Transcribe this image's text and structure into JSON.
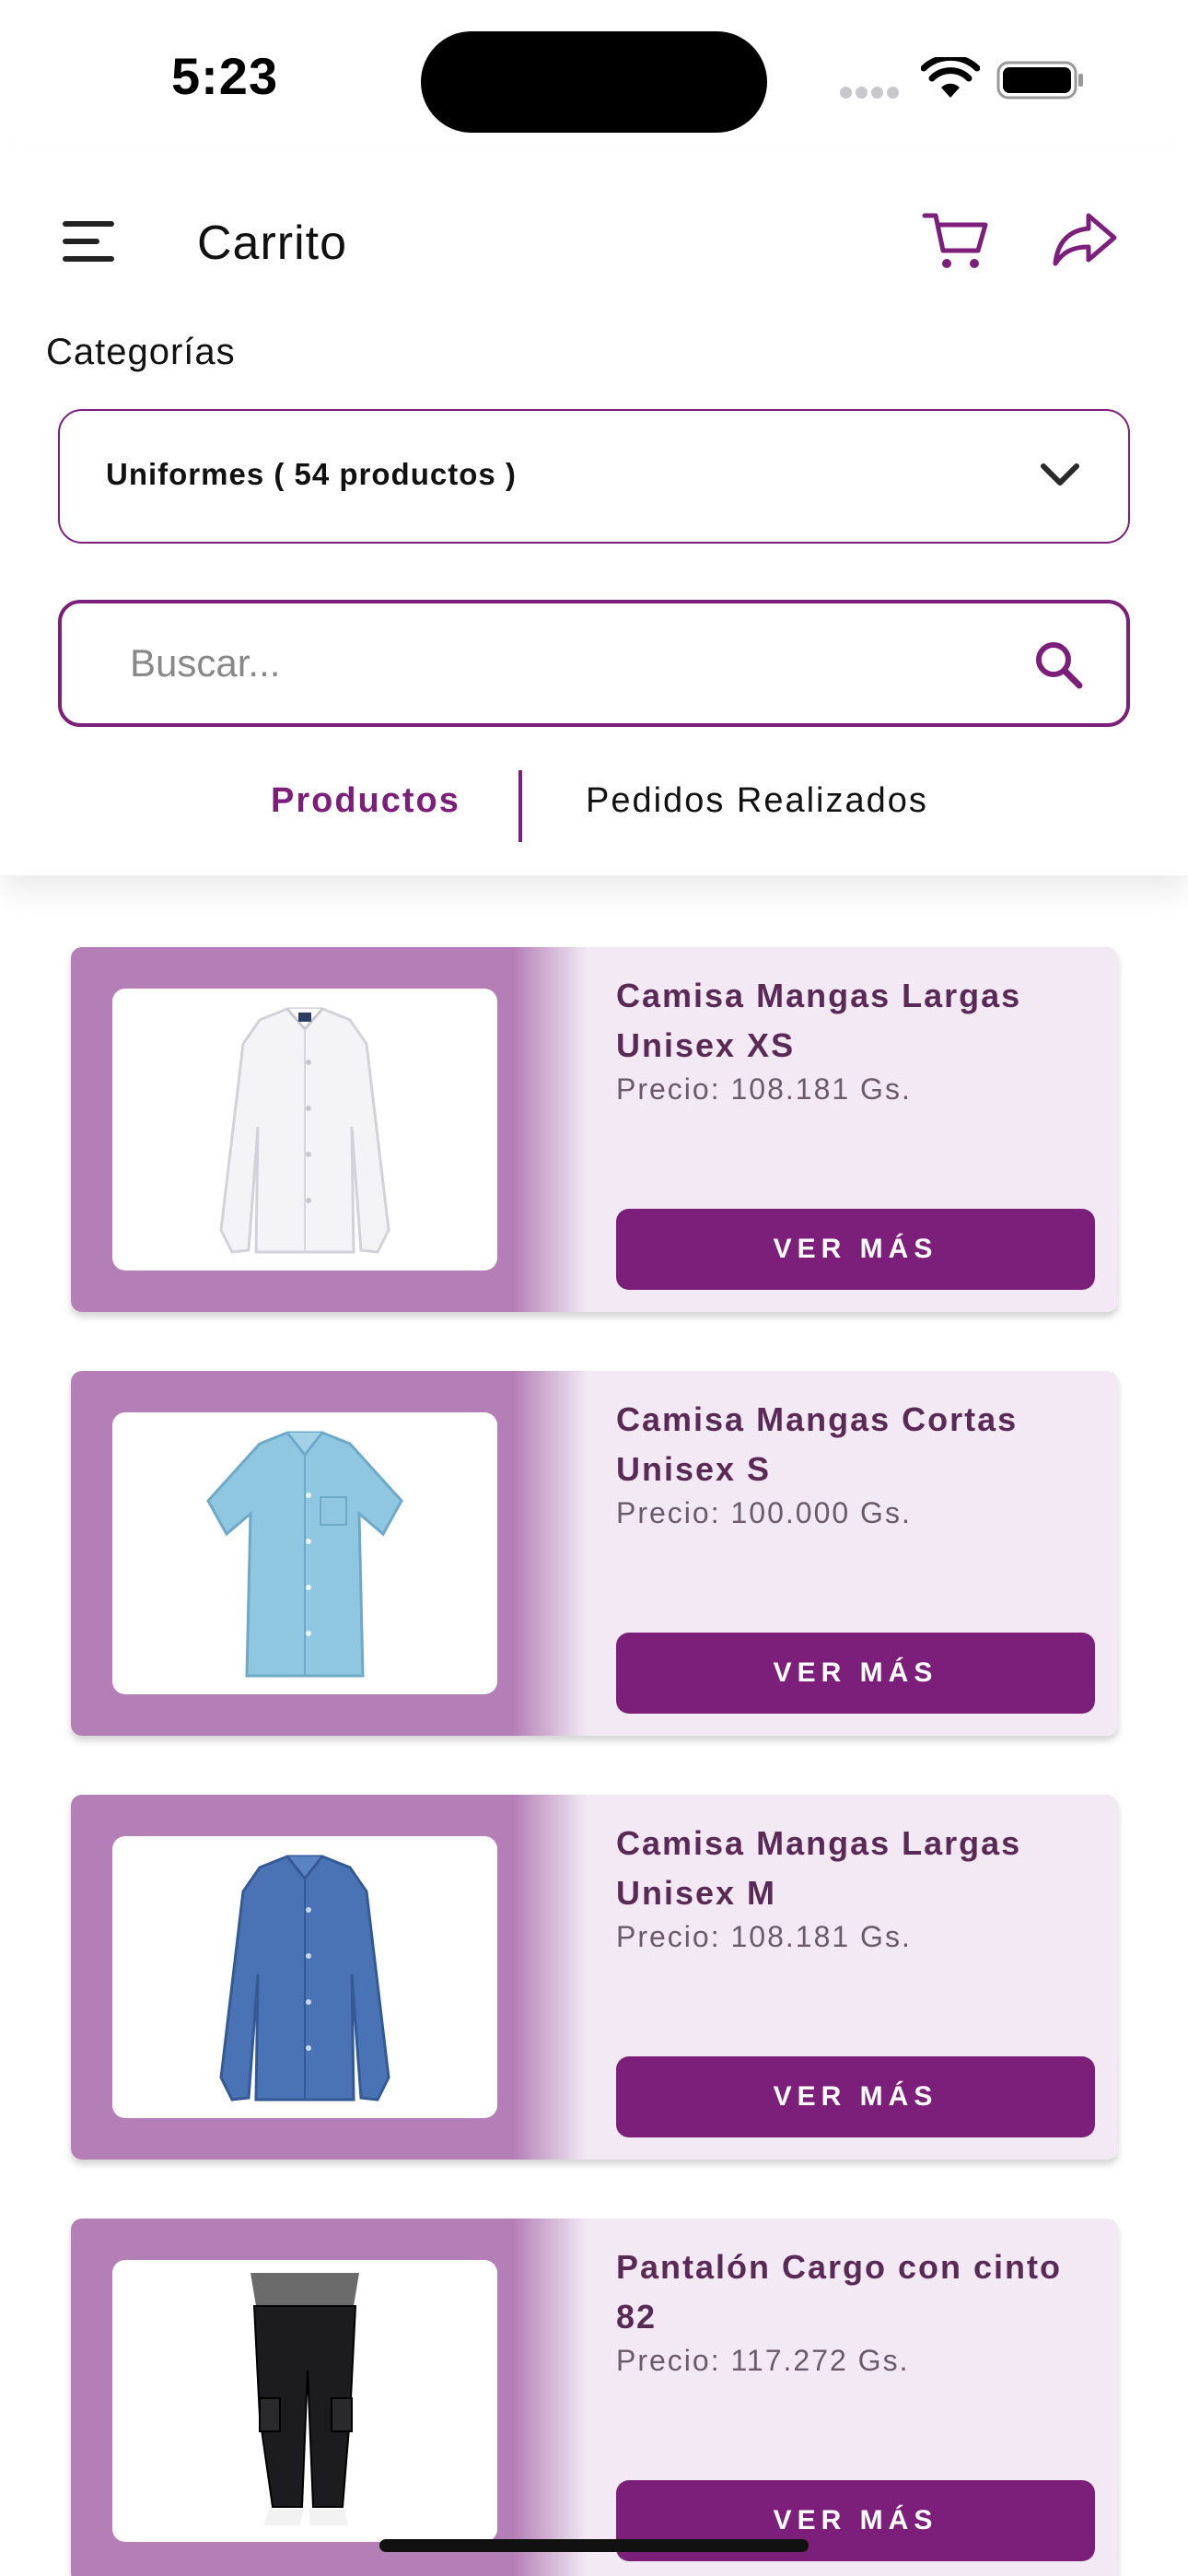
{
  "status_bar": {
    "time": "5:23"
  },
  "header": {
    "title": "Carrito",
    "category_label": "Categorías",
    "category_selected": "Uniformes ( 54 productos )",
    "search_placeholder": "Buscar...",
    "tabs": [
      {
        "label": "Productos",
        "active": true
      },
      {
        "label": "Pedidos Realizados",
        "active": false
      }
    ]
  },
  "colors": {
    "accent": "#7b1f7b",
    "card_left": "#b47eb6",
    "card_right": "#f2e9f4"
  },
  "products": [
    {
      "name": "Camisa Mangas Largas Unisex XS",
      "price": "Precio: 108.181 Gs.",
      "button": "VER MÁS",
      "image": "white-long-sleeve-shirt"
    },
    {
      "name": "Camisa Mangas Cortas Unisex S",
      "price": "Precio: 100.000 Gs.",
      "button": "VER MÁS",
      "image": "light-blue-short-sleeve-shirt"
    },
    {
      "name": "Camisa Mangas Largas Unisex M",
      "price": "Precio: 108.181 Gs.",
      "button": "VER MÁS",
      "image": "blue-long-sleeve-shirt"
    },
    {
      "name": "Pantalón Cargo con cinto 82",
      "price": "Precio: 117.272 Gs.",
      "button": "VER MÁS",
      "image": "black-cargo-pants"
    }
  ]
}
